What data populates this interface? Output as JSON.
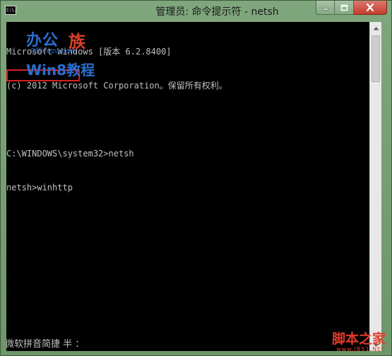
{
  "window": {
    "title": "管理员: 命令提示符 - netsh",
    "icon_label": "C:\\."
  },
  "console": {
    "lines": [
      "Microsoft Windows [版本 6.2.8400]",
      "(c) 2012 Microsoft Corporation。保留所有权利。",
      "",
      "C:\\WINDOWS\\system32>netsh",
      "netsh>winhttp"
    ],
    "ime_status": "微软拼音简捷 半 ："
  },
  "watermarks": {
    "logo_main": "办公",
    "logo_zu": "族",
    "logo_url": "Officezu.com",
    "logo_win8": "Win8教程",
    "jb_main": "脚本之家",
    "jb_url": "www.JB51.NET"
  },
  "colors": {
    "highlight": "#d62020",
    "console_bg": "#000000",
    "console_text": "#c0c0c0"
  }
}
